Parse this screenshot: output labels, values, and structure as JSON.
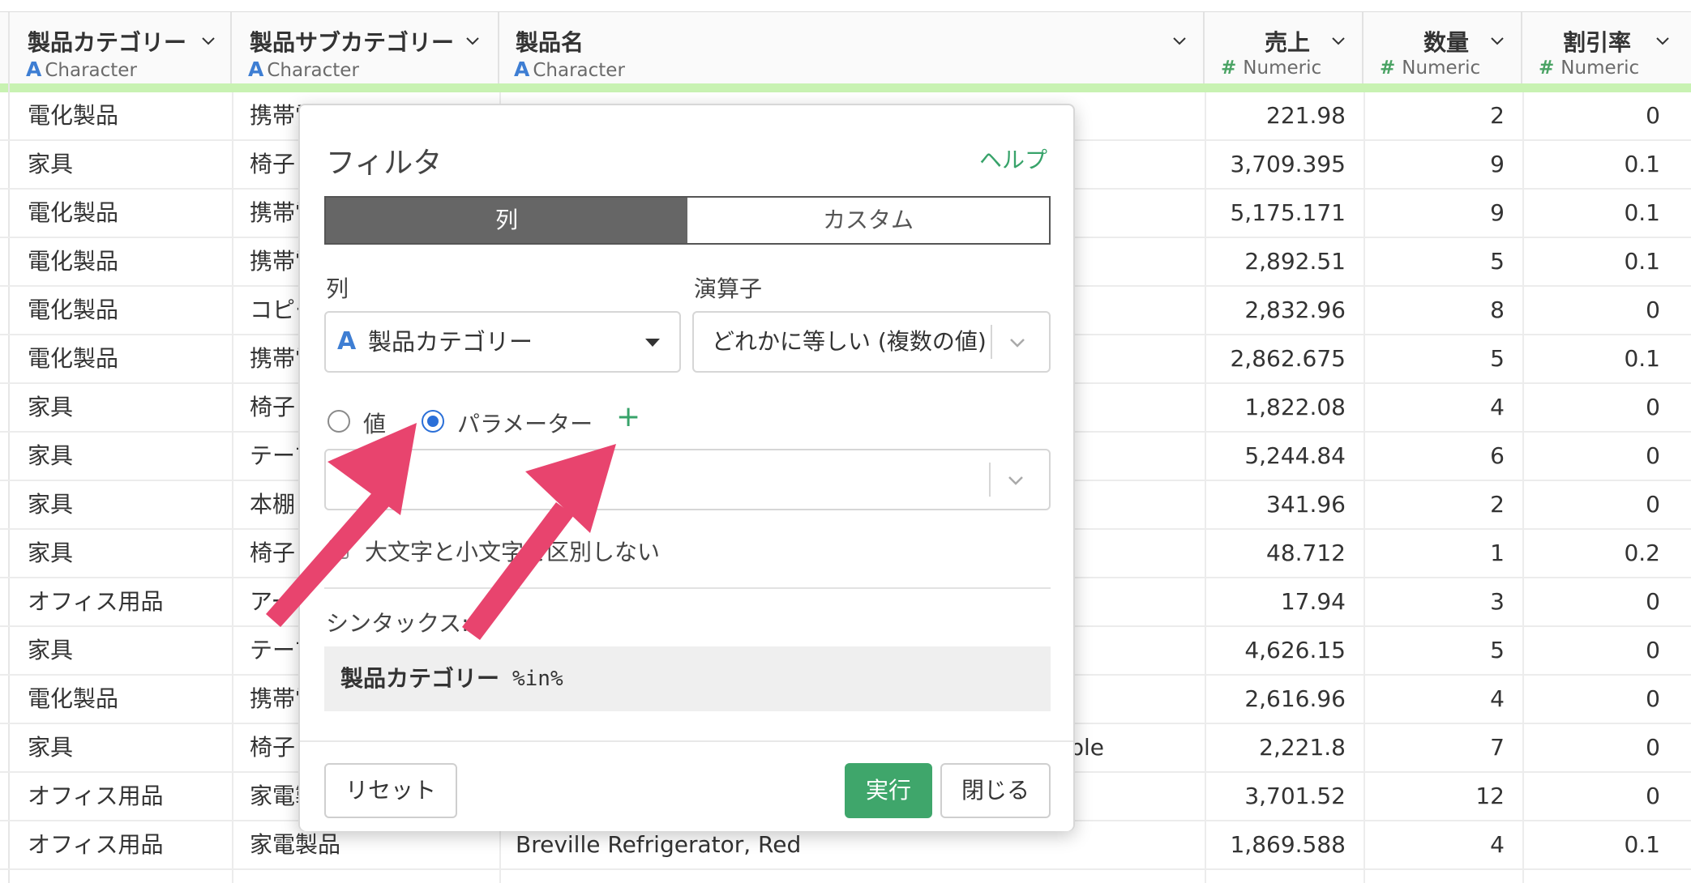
{
  "columns": [
    {
      "name": "製品カテゴリー",
      "type": "Character",
      "type_icon": "A"
    },
    {
      "name": "製品サブカテゴリー",
      "type": "Character",
      "type_icon": "A"
    },
    {
      "name": "製品名",
      "type": "Character",
      "type_icon": "A"
    },
    {
      "name": "売上",
      "type": "Numeric",
      "type_icon": "#"
    },
    {
      "name": "数量",
      "type": "Numeric",
      "type_icon": "#"
    },
    {
      "name": "割引率",
      "type": "Numeric",
      "type_icon": "#"
    }
  ],
  "rows": [
    {
      "cat": "電化製品",
      "sub": "携帯電",
      "name": "",
      "sales": "221.98",
      "qty": "2",
      "disc": "0"
    },
    {
      "cat": "家具",
      "sub": "椅子",
      "name": "",
      "sales": "3,709.395",
      "qty": "9",
      "disc": "0.1"
    },
    {
      "cat": "電化製品",
      "sub": "携帯電",
      "name": "",
      "sales": "5,175.171",
      "qty": "9",
      "disc": "0.1"
    },
    {
      "cat": "電化製品",
      "sub": "携帯電",
      "name": "",
      "sales": "2,892.51",
      "qty": "5",
      "disc": "0.1"
    },
    {
      "cat": "電化製品",
      "sub": "コピー",
      "name": "",
      "sales": "2,832.96",
      "qty": "8",
      "disc": "0"
    },
    {
      "cat": "電化製品",
      "sub": "携帯電",
      "name": "",
      "sales": "2,862.675",
      "qty": "5",
      "disc": "0.1"
    },
    {
      "cat": "家具",
      "sub": "椅子",
      "name": "",
      "sales": "1,822.08",
      "qty": "4",
      "disc": "0"
    },
    {
      "cat": "家具",
      "sub": "テーブ",
      "name": "",
      "sales": "5,244.84",
      "qty": "6",
      "disc": "0"
    },
    {
      "cat": "家具",
      "sub": "本棚",
      "name": "",
      "sales": "341.96",
      "qty": "2",
      "disc": "0"
    },
    {
      "cat": "家具",
      "sub": "椅子",
      "name": "",
      "sales": "48.712",
      "qty": "1",
      "disc": "0.2"
    },
    {
      "cat": "オフィス用品",
      "sub": "アー",
      "name": "",
      "sales": "17.94",
      "qty": "3",
      "disc": "0"
    },
    {
      "cat": "家具",
      "sub": "テーブ",
      "name": "",
      "sales": "4,626.15",
      "qty": "5",
      "disc": "0"
    },
    {
      "cat": "電化製品",
      "sub": "携帯電",
      "name": "",
      "sales": "2,616.96",
      "qty": "4",
      "disc": "0"
    },
    {
      "cat": "家具",
      "sub": "椅子",
      "name": "ble",
      "sales": "2,221.8",
      "qty": "7",
      "disc": "0"
    },
    {
      "cat": "オフィス用品",
      "sub": "家電製",
      "name": "",
      "sales": "3,701.52",
      "qty": "12",
      "disc": "0"
    },
    {
      "cat": "オフィス用品",
      "sub": "家電製品",
      "name": "Breville Refrigerator, Red",
      "sales": "1,869.588",
      "qty": "4",
      "disc": "0.1"
    }
  ],
  "filter_dialog": {
    "title": "フィルタ",
    "help_link": "ヘルプ",
    "tabs": {
      "column": "列",
      "custom": "カスタム"
    },
    "column_label": "列",
    "column_value": "製品カテゴリー",
    "column_type_icon": "A",
    "operator_label": "演算子",
    "operator_value": "どれかに等しい (複数の値)",
    "radio_value_label": "値",
    "radio_param_label": "パラメーター",
    "plus": "+",
    "param_placeholder": "",
    "case_insensitive_label": "大文字と小文字を区別しない",
    "syntax_label": "シンタックス:",
    "syntax_column": "製品カテゴリー",
    "syntax_operator": "%in%",
    "reset_button": "リセット",
    "run_button": "実行",
    "close_button": "閉じる"
  },
  "colors": {
    "accent_green": "#3fa66b",
    "radio_blue": "#2a6fd8",
    "arrow_pink": "#e8446e",
    "header_accent": "#c8f2b2"
  }
}
